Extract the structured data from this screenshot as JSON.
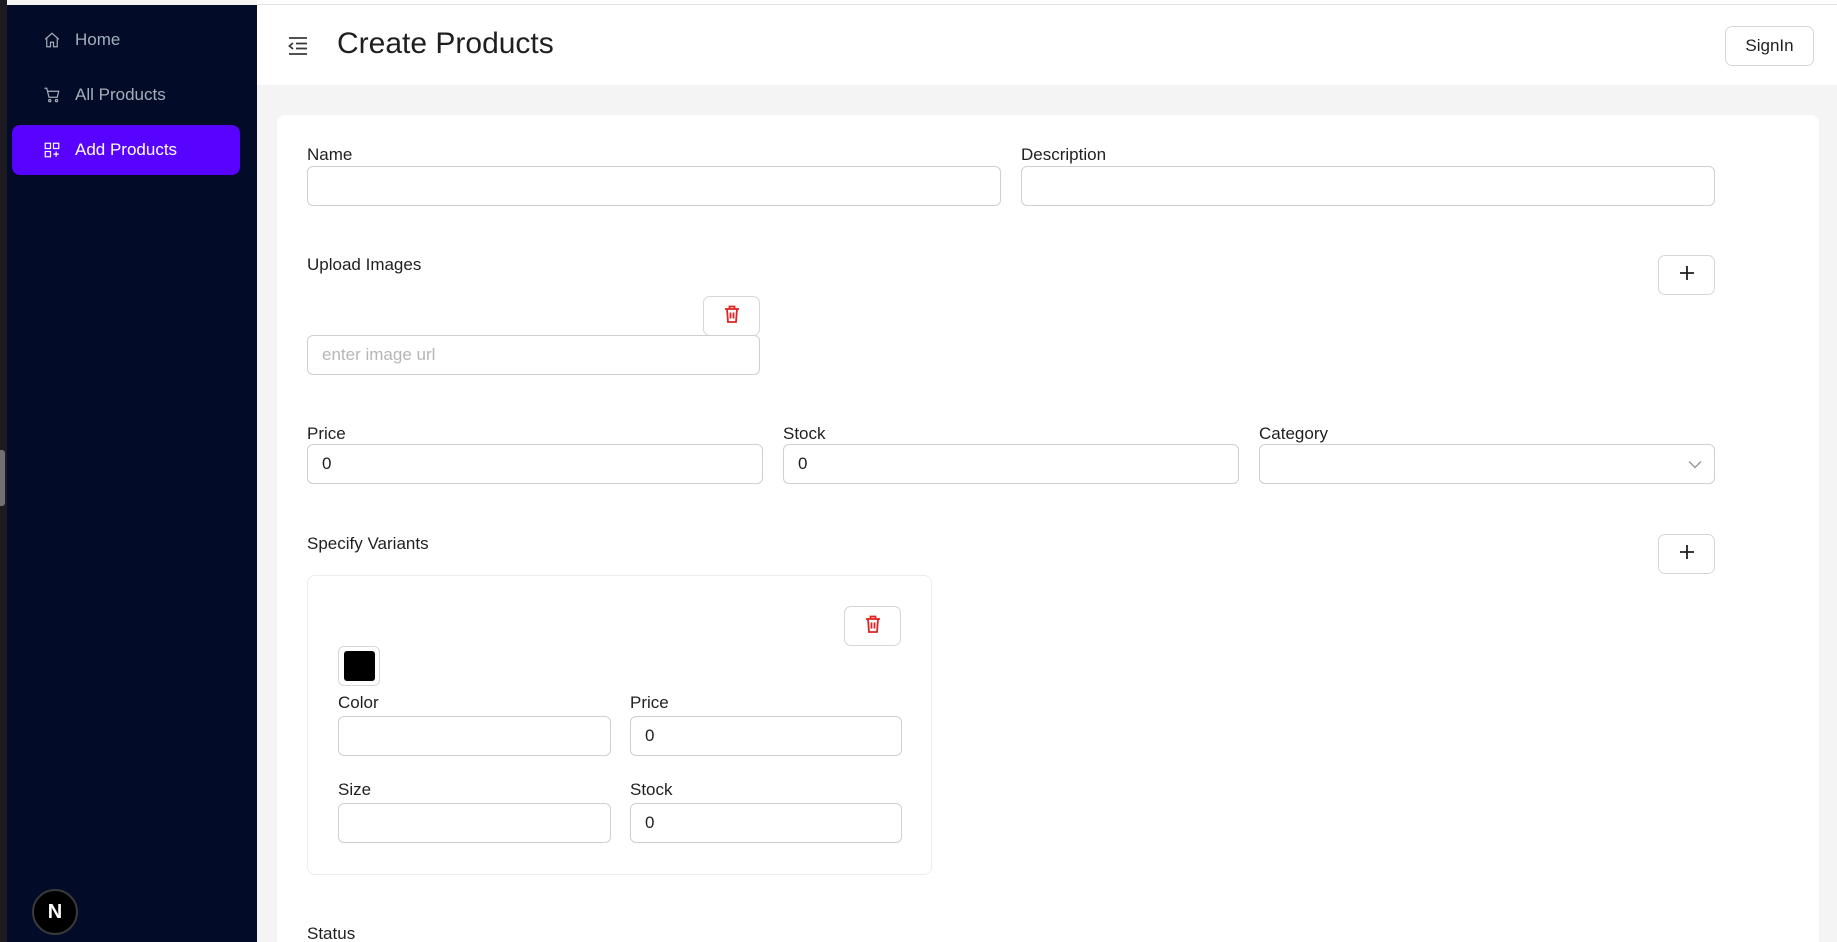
{
  "sidebar": {
    "items": [
      {
        "label": "Home",
        "icon": "home-icon",
        "active": false
      },
      {
        "label": "All Products",
        "icon": "cart-icon",
        "active": false
      },
      {
        "label": "Add Products",
        "icon": "grid-add-icon",
        "active": true
      }
    ],
    "logo_letter": "N"
  },
  "header": {
    "title": "Create Products",
    "signin_label": "SignIn"
  },
  "form": {
    "name": {
      "label": "Name",
      "value": ""
    },
    "description": {
      "label": "Description",
      "value": ""
    },
    "upload": {
      "label": "Upload Images",
      "placeholder": "enter image url",
      "value": ""
    },
    "price": {
      "label": "Price",
      "value": "0"
    },
    "stock": {
      "label": "Stock",
      "value": "0"
    },
    "category": {
      "label": "Category",
      "selected": ""
    },
    "variants": {
      "label": "Specify Variants",
      "items": [
        {
          "swatch_color": "#000000",
          "color": {
            "label": "Color",
            "value": ""
          },
          "price": {
            "label": "Price",
            "value": "0"
          },
          "size": {
            "label": "Size",
            "value": ""
          },
          "stock": {
            "label": "Stock",
            "value": "0"
          }
        }
      ]
    },
    "status": {
      "label": "Status"
    }
  },
  "colors": {
    "accent": "#5703ff",
    "sidebar_bg": "#020c28",
    "danger": "#e02424"
  }
}
